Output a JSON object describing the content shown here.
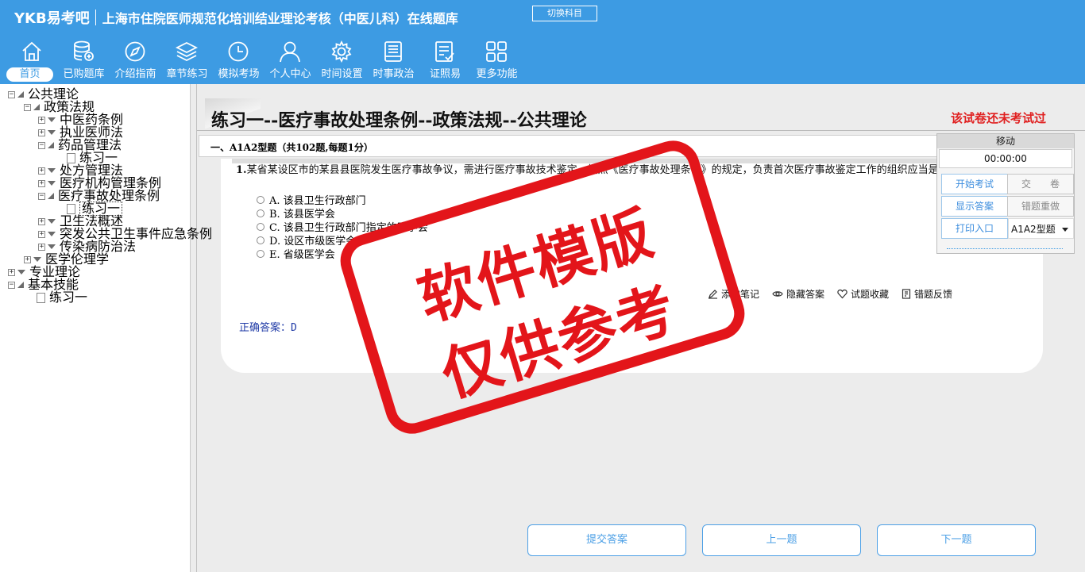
{
  "header": {
    "logo": "YKB易考吧",
    "title": "上海市住院医师规范化培训结业理论考核（中医儿科）在线题库",
    "switch_label": "切换科目"
  },
  "nav": [
    {
      "label": "首页",
      "icon": "home-icon",
      "active": true
    },
    {
      "label": "已购题库",
      "icon": "database-icon"
    },
    {
      "label": "介绍指南",
      "icon": "compass-icon"
    },
    {
      "label": "章节练习",
      "icon": "layers-icon"
    },
    {
      "label": "模拟考场",
      "icon": "clock-icon"
    },
    {
      "label": "个人中心",
      "icon": "user-icon"
    },
    {
      "label": "时间设置",
      "icon": "gear-icon"
    },
    {
      "label": "时事政治",
      "icon": "news-icon"
    },
    {
      "label": "证照易",
      "icon": "checklist-icon"
    },
    {
      "label": "更多功能",
      "icon": "grid-icon"
    }
  ],
  "tree": {
    "n0": "公共理论",
    "n1": "政策法规",
    "n2": "中医药条例",
    "n3": "执业医师法",
    "n4": "药品管理法",
    "n5": "练习一",
    "n6": "处方管理法",
    "n7": "医疗机构管理条例",
    "n8": "医疗事故处理条例",
    "n9": "练习一",
    "n10": "卫生法概述",
    "n11": "突发公共卫生事件应急条例",
    "n12": "传染病防治法",
    "n13": "医学伦理学",
    "n14": "专业理论",
    "n15": "基本技能",
    "n16": "练习一"
  },
  "main": {
    "title": "练习一--医疗事故处理条例--政策法规--公共理论",
    "status": "该试卷还未考试过",
    "section_title": "一、A1A2型题（共102题,每题1分）",
    "question": {
      "number": "1.",
      "text": "某省某设区市的某县县医院发生医疗事故争议，需进行医疗事故技术鉴定，按照《医疗事故处理条例》的规定，负责首次医疗事故鉴定工作的组织应当是( )",
      "options": [
        "A. 该县卫生行政部门",
        "B. 该县医学会",
        "C. 该县卫生行政部门指定的医学会",
        "D. 设区市级医学会",
        "E. 省级医学会"
      ]
    },
    "actions": {
      "note": "添加笔记",
      "hide_answer": "隐藏答案",
      "favorite": "试题收藏",
      "feedback": "错题反馈"
    },
    "answer_label": "正确答案：",
    "answer_value": "D"
  },
  "panel": {
    "move": "移动",
    "timer": "00:00:00",
    "start": "开始考试",
    "submit": "交　　卷",
    "show_answer": "显示答案",
    "redo": "错题重做",
    "print": "打印入口",
    "type_select": "A1A2型题"
  },
  "bottom": {
    "submit_answer": "提交答案",
    "prev": "上一题",
    "next": "下一题"
  },
  "watermark": {
    "line1": "软件模版",
    "line2": "仅供参考"
  },
  "colors": {
    "header_bg": "#3d9be3",
    "status_red": "#e02020",
    "answer_blue": "#1f3aa6",
    "stamp_red": "#e3151a"
  }
}
